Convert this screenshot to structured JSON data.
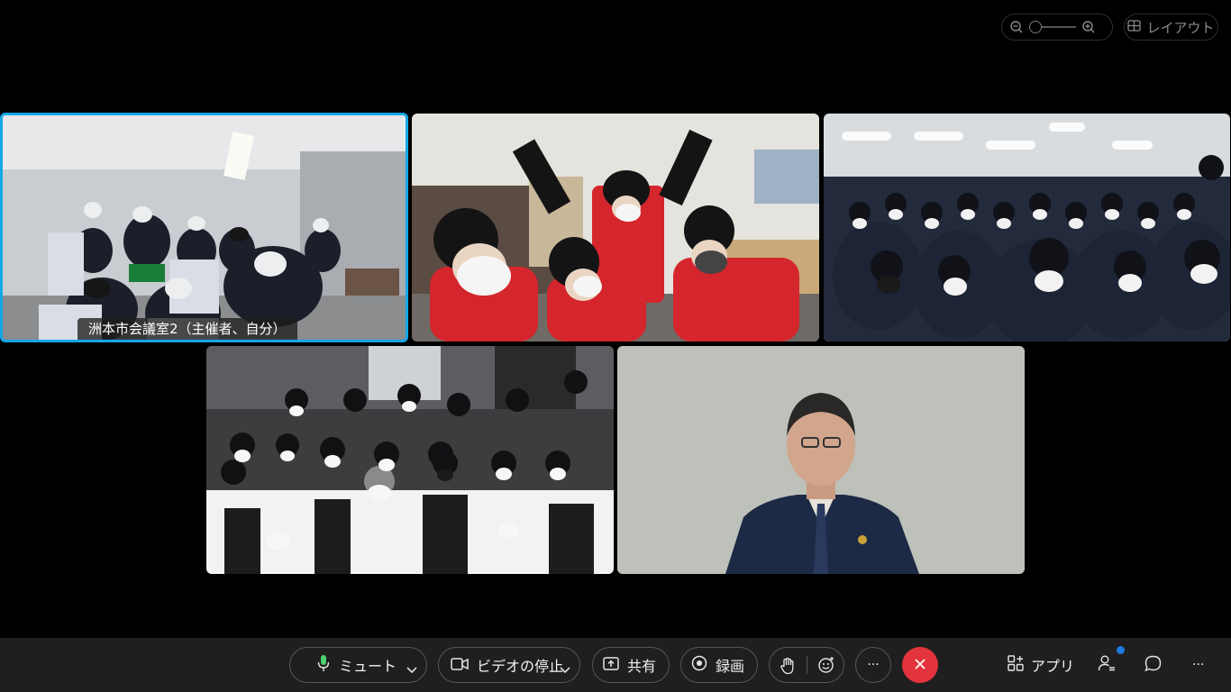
{
  "view_controls": {
    "zoom_icon_minus": "zoom-out-icon",
    "zoom_icon_plus": "zoom-in-icon",
    "zoom_level": 0,
    "layout_label": "レイアウト"
  },
  "tiles": [
    {
      "id": "tile-1",
      "name_label": "洲本市会議室2（主催者、自分）",
      "active": true
    },
    {
      "id": "tile-2",
      "active": false
    },
    {
      "id": "tile-3",
      "active": false
    },
    {
      "id": "tile-4",
      "active": false
    },
    {
      "id": "tile-5",
      "active": false
    }
  ],
  "toolbar": {
    "mute_label": "ミュート",
    "video_label": "ビデオの停止",
    "share_label": "共有",
    "record_label": "録画",
    "raise_hand_icon": "raise-hand-icon",
    "reactions_icon": "reactions-icon",
    "more_label": "···",
    "end_call_icon": "close-icon",
    "apps_label": "アプリ",
    "participants_icon": "participants-icon",
    "chat_icon": "chat-icon",
    "overflow_label": "···"
  },
  "colors": {
    "active_speaker_border": "#13a8e6",
    "end_call": "#e3333c",
    "toolbar_bg": "#1f1f1f",
    "notification_dot": "#1f7ae0"
  }
}
